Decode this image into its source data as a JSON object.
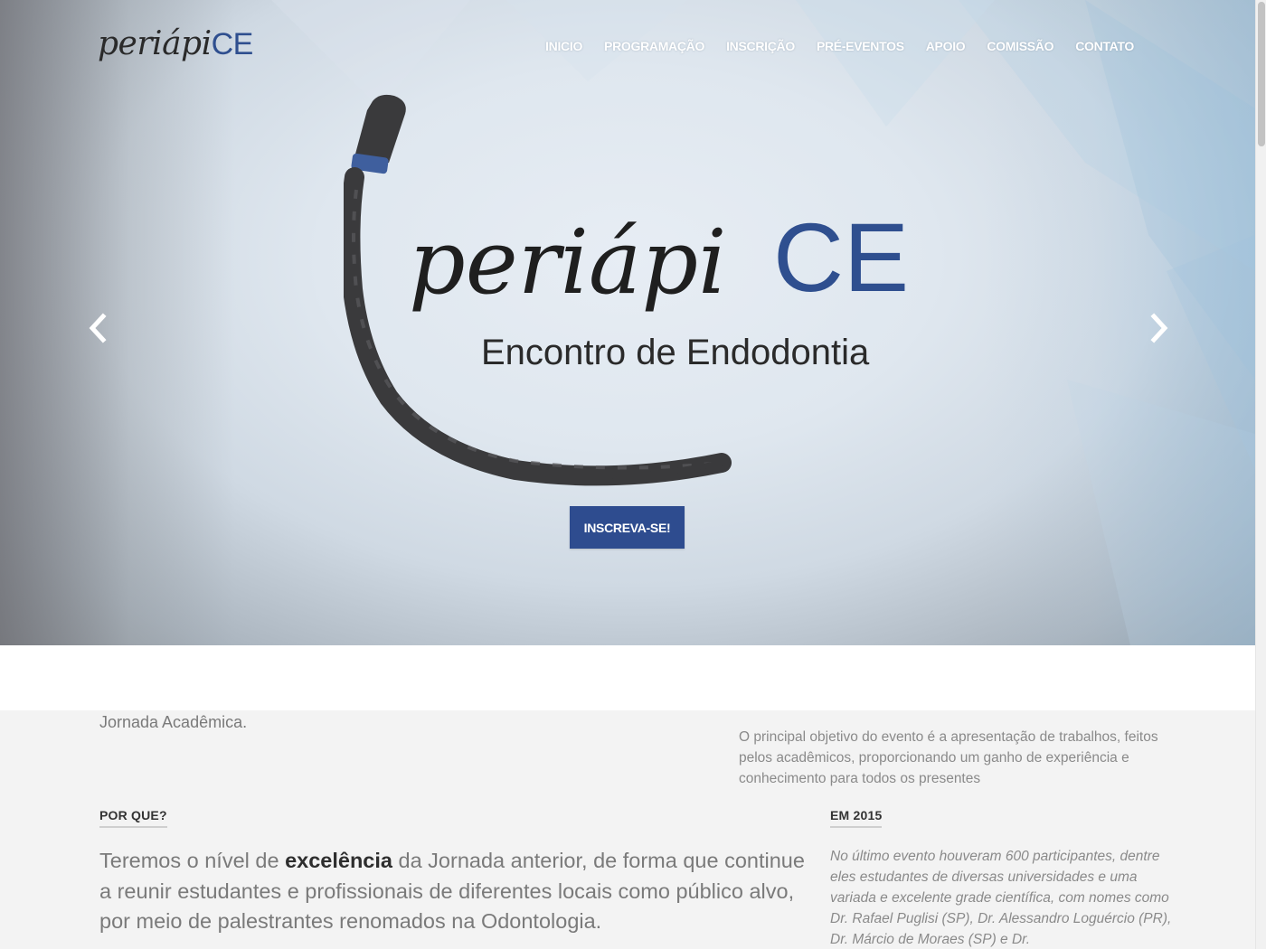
{
  "brand": {
    "name_part1": "periápi",
    "name_part2": "CE"
  },
  "nav": {
    "items": [
      {
        "label": "INICIO"
      },
      {
        "label": "PROGRAMAÇÃO"
      },
      {
        "label": "INSCRIÇÃO"
      },
      {
        "label": "PRÉ-EVENTOS"
      },
      {
        "label": "APOIO"
      },
      {
        "label": "COMISSÃO"
      },
      {
        "label": "CONTATO"
      }
    ]
  },
  "hero": {
    "logo_title_part1": "periápi",
    "logo_title_part2": "CE",
    "logo_subtitle": "Encontro de Endodontia",
    "cta_label": "INSCREVA-SE!",
    "colors": {
      "accent": "#2e4c8f",
      "band": "#3f5f9e"
    }
  },
  "intro": {
    "left_fragment": "Jornada Acadêmica.",
    "right_text": "O principal objetivo do evento é a apresentação de trabalhos, feitos pelos acadêmicos, proporcionando um ganho de experiência e conhecimento para todos os presentes"
  },
  "why": {
    "heading": "POR QUE?",
    "text_before": "Teremos o nível de ",
    "text_bold": "excelência",
    "text_after": " da Jornada anterior, de forma que continue a reunir estudantes e profissionais de diferentes locais como público alvo, por meio de palestrantes renomados na Odontologia."
  },
  "y2015": {
    "heading": "EM 2015",
    "text": "No último evento houveram 600 participantes, dentre eles estudantes de diversas universidades e uma variada e excelente grade científica, com nomes como Dr. Rafael Puglisi (SP), Dr. Alessandro Loguércio (PR), Dr. Márcio de Moraes (SP) e Dr."
  },
  "icons": {
    "prev": "chevron-left-icon",
    "next": "chevron-right-icon"
  }
}
